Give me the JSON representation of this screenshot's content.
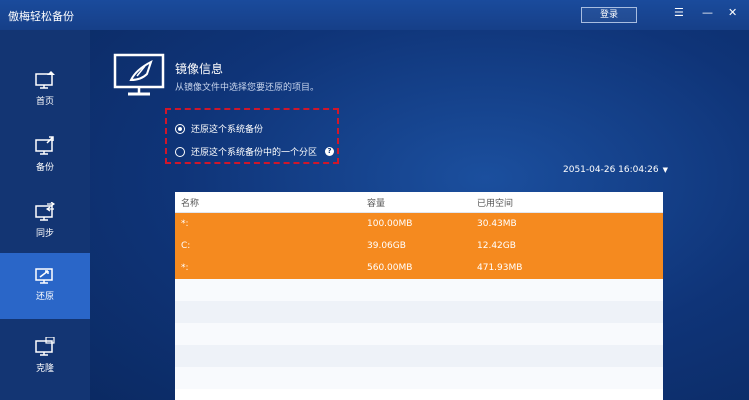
{
  "app": {
    "title": "傲梅轻松备份",
    "login_label": "登录"
  },
  "window": {
    "menu_icon": "☰",
    "minimize_icon": "—",
    "close_icon": "✕"
  },
  "sidebar": {
    "items": [
      {
        "label": "首页",
        "icon": "home-monitor-icon",
        "active": false
      },
      {
        "label": "备份",
        "icon": "backup-monitor-icon",
        "active": false
      },
      {
        "label": "同步",
        "icon": "sync-monitor-icon",
        "active": false
      },
      {
        "label": "还原",
        "icon": "restore-monitor-icon",
        "active": true
      },
      {
        "label": "克隆",
        "icon": "clone-monitor-icon",
        "active": false
      }
    ]
  },
  "main": {
    "title": "镜像信息",
    "description": "从镜像文件中选择您要还原的项目。",
    "options": [
      {
        "label": "还原这个系统备份",
        "checked": true
      },
      {
        "label": "还原这个系统备份中的一个分区",
        "checked": false
      }
    ],
    "date": "2051-04-26 16:04:26",
    "table": {
      "headers": [
        "名称",
        "容量",
        "已用空间"
      ],
      "rows": [
        {
          "name": "*:",
          "capacity": "100.00MB",
          "used": "30.43MB"
        },
        {
          "name": "C:",
          "capacity": "39.06GB",
          "used": "12.42GB"
        },
        {
          "name": "*:",
          "capacity": "560.00MB",
          "used": "471.93MB"
        }
      ]
    }
  },
  "colors": {
    "accent_orange": "#f58a1f",
    "highlight_red": "#d0162a",
    "active_blue": "#2a66c8"
  }
}
